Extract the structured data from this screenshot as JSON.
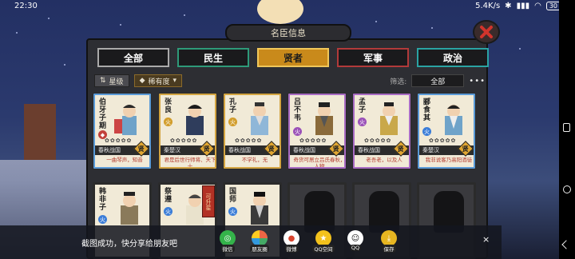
{
  "status": {
    "time": "22:30",
    "net": "5.4K/s",
    "battery": "30"
  },
  "window_title": "名臣信息",
  "tabs": [
    "全部",
    "民生",
    "贤者",
    "军事",
    "政治"
  ],
  "filter": {
    "sort_label": "星级",
    "rarity_label": "稀有度",
    "filter_label": "筛选:",
    "filter_value": "全部",
    "more": "•••"
  },
  "cards": [
    {
      "name": "伯牙子期",
      "seal": "blue",
      "stars": "✿✿✿✿✿",
      "era": "春秋战国",
      "badge": "贤",
      "desc": "一曲琴声，知音",
      "border": "b-blue"
    },
    {
      "name": "张良",
      "seal": "gold",
      "seal_char": "火",
      "stars": "✿✿✿✿✿",
      "era": "秦楚汉",
      "badge": "贤",
      "desc": "君是后世行师将、天下士",
      "border": "b-gold"
    },
    {
      "name": "孔子",
      "seal": "gold",
      "seal_char": "火",
      "stars": "✿✿✿✿✿",
      "era": "春秋战国",
      "badge": "贤",
      "desc": "不学礼，无",
      "border": "b-gold"
    },
    {
      "name": "吕不韦",
      "seal": "purple",
      "seal_char": "火",
      "stars": "✿✿✿✿✿",
      "era": "春秋战国",
      "badge": "贤",
      "desc": "奇货可居立吕氏春秋，人物",
      "border": "b-purple"
    },
    {
      "name": "孟子",
      "seal": "purple",
      "seal_char": "火",
      "stars": "✿✿✿✿✿",
      "era": "春秋战国",
      "badge": "贤",
      "desc": "老吾老，以及人",
      "border": "b-purple"
    },
    {
      "name": "郦食其",
      "seal": "blue",
      "seal_char": "火",
      "stars": "✿✿✿✿✿",
      "era": "秦楚汉",
      "badge": "贤",
      "desc": "我非说客乃高阳酒徒",
      "border": "b-blue"
    },
    {
      "name": "韩非子",
      "seal": "blue",
      "seal_char": "火",
      "stars": "",
      "era": "",
      "badge": "",
      "desc": "",
      "border": ""
    },
    {
      "name": "祭遵",
      "seal": "blue",
      "seal_char": "火",
      "stars": "",
      "era": "",
      "badge": "",
      "desc": "",
      "border": ""
    },
    {
      "name": "国师",
      "seal": "blue",
      "seal_char": "火",
      "stars": "",
      "era": "",
      "badge": "",
      "desc": "",
      "border": ""
    }
  ],
  "banner": "可升星",
  "toast": {
    "message": "截图成功，快分享给朋友吧",
    "share": [
      {
        "label": "微信",
        "icon": "wechat-icon",
        "color": "#34b34a"
      },
      {
        "label": "朋友圈",
        "icon": "moments-icon",
        "color": "#d8b02b"
      },
      {
        "label": "微博",
        "icon": "weibo-icon",
        "color": "#d9452f"
      },
      {
        "label": "QQ空间",
        "icon": "qzone-icon",
        "color": "#f3c21c"
      },
      {
        "label": "QQ",
        "icon": "qq-icon",
        "color": "#1b1b1b"
      },
      {
        "label": "保存",
        "icon": "save-icon",
        "color": "#e6b521"
      }
    ],
    "close": "×"
  }
}
